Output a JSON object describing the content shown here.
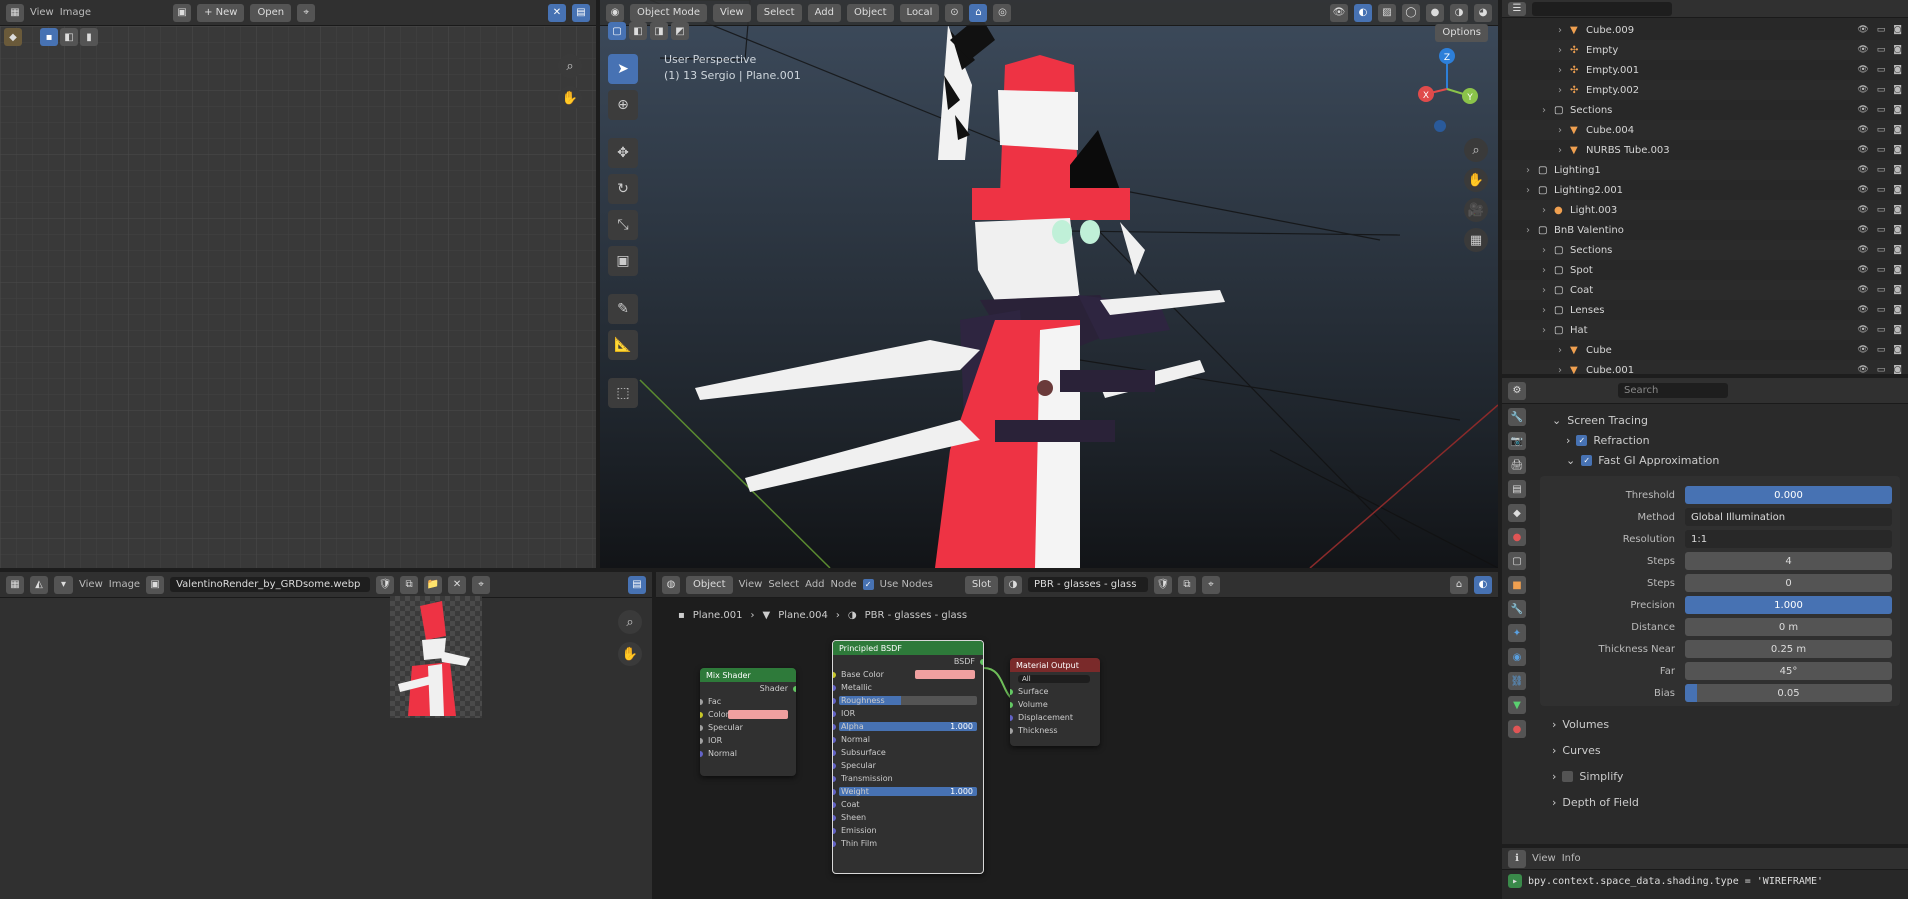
{
  "colors": {
    "accent": "#4772b3",
    "viewport_top": "#3c4a5a",
    "viewport_bottom": "#121417",
    "header": "#303030",
    "shader_node_header": "#2e7a3a",
    "output_node_header": "#7a2a2a",
    "pink_swatch": "#f0a0a0"
  },
  "uv_editor": {
    "menus": [
      "View",
      "Image"
    ],
    "new_label": "+ New",
    "open_label": "Open"
  },
  "viewport": {
    "mode": "Object Mode",
    "menus": [
      "View",
      "Select",
      "Add",
      "Object"
    ],
    "transform": "Local",
    "options_label": "Options",
    "overlay_line1": "User Perspective",
    "overlay_line2": "(1) 13 Sergio | Plane.001",
    "gizmo_axes": [
      "X",
      "Y",
      "Z"
    ]
  },
  "outliner": {
    "rows": [
      {
        "name": "Cube.009",
        "indent": 3,
        "icon": "mesh-icon"
      },
      {
        "name": "Empty",
        "indent": 3,
        "icon": "empty-icon"
      },
      {
        "name": "Empty.001",
        "indent": 3,
        "icon": "empty-icon"
      },
      {
        "name": "Empty.002",
        "indent": 3,
        "icon": "empty-icon"
      },
      {
        "name": "Sections",
        "indent": 2,
        "icon": "collection-icon"
      },
      {
        "name": "Cube.004",
        "indent": 3,
        "icon": "mesh-icon"
      },
      {
        "name": "NURBS Tube.003",
        "indent": 3,
        "icon": "mesh-icon"
      },
      {
        "name": "Lighting1",
        "indent": 1,
        "icon": "collection-icon"
      },
      {
        "name": "Lighting2.001",
        "indent": 1,
        "icon": "collection-icon"
      },
      {
        "name": "Light.003",
        "indent": 2,
        "icon": "light-icon"
      },
      {
        "name": "BnB Valentino",
        "indent": 1,
        "icon": "collection-icon"
      },
      {
        "name": "Sections",
        "indent": 2,
        "icon": "collection-icon"
      },
      {
        "name": "Spot",
        "indent": 2,
        "icon": "collection-icon"
      },
      {
        "name": "Coat",
        "indent": 2,
        "icon": "collection-icon"
      },
      {
        "name": "Lenses",
        "indent": 2,
        "icon": "collection-icon"
      },
      {
        "name": "Hat",
        "indent": 2,
        "icon": "collection-icon"
      },
      {
        "name": "Cube",
        "indent": 3,
        "icon": "mesh-icon"
      },
      {
        "name": "Cube.001",
        "indent": 3,
        "icon": "mesh-icon"
      }
    ]
  },
  "properties": {
    "search_placeholder": "Search",
    "section_screen_tracing": "Screen Tracing",
    "sub_refraction": "Refraction",
    "sub_fast_gi": "Fast GI Approximation",
    "rows": [
      {
        "label": "Threshold",
        "value": "0.000",
        "kind": "full"
      },
      {
        "label": "Method",
        "value": "Global Illumination",
        "kind": "select"
      },
      {
        "label": "Resolution",
        "value": "1:1",
        "kind": "select"
      },
      {
        "label": "Steps",
        "value": "4",
        "kind": "num"
      },
      {
        "label": "Steps",
        "value": "0",
        "kind": "num"
      },
      {
        "label": "Precision",
        "value": "1.000",
        "kind": "full"
      },
      {
        "label": "Distance",
        "value": "0 m",
        "kind": "num"
      },
      {
        "label": "Thickness Near",
        "value": "0.25 m",
        "kind": "num"
      },
      {
        "label": "Far",
        "value": "45°",
        "kind": "num"
      },
      {
        "label": "Bias",
        "value": "0.05",
        "kind": "bias"
      }
    ],
    "collapsed": [
      "Volumes",
      "Curves",
      "Simplify",
      "Depth of Field"
    ]
  },
  "image_editor": {
    "menus": [
      "View",
      "Image"
    ],
    "image_name": "ValentinoRender_by_GRDsome.webp"
  },
  "node_editor": {
    "editor_type": "Object",
    "menus": [
      "View",
      "Select",
      "Add",
      "Node"
    ],
    "use_nodes": "Use Nodes",
    "slot": "Slot",
    "material": "PBR - glasses - glass",
    "breadcrumb": [
      "Plane.001",
      "Plane.004",
      "PBR - glasses - glass"
    ],
    "nodes": {
      "left": {
        "title": "Mix Shader",
        "rows": [
          "Shader",
          "Fac",
          "Color",
          "Specular",
          "IOR",
          "Normal"
        ]
      },
      "center": {
        "title": "Principled BSDF",
        "rows": [
          "BSDF",
          "Base Color",
          "Metallic",
          "Roughness",
          "IOR",
          "Alpha",
          "Normal",
          "Subsurface",
          "Specular",
          "Transmission",
          "Weight",
          "Coat",
          "Sheen",
          "Emission",
          "Thin Film"
        ],
        "alpha_value": "1.000",
        "weight_value": "1.000"
      },
      "output": {
        "title": "Material Output",
        "target": "All",
        "rows": [
          "Surface",
          "Volume",
          "Displacement",
          "Thickness"
        ]
      }
    }
  },
  "info": {
    "menus": [
      "View",
      "Info"
    ],
    "log": "bpy.context.space_data.shading.type = 'WIREFRAME'"
  }
}
